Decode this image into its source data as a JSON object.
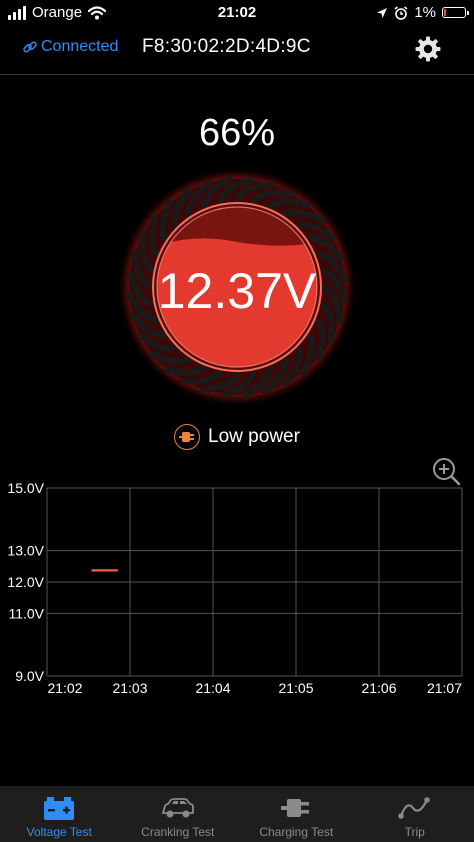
{
  "status_bar": {
    "carrier": "Orange",
    "time": "21:02",
    "battery_percent": "1%"
  },
  "header": {
    "connection_label": "Connected",
    "device_address": "F8:30:02:2D:4D:9C"
  },
  "battery": {
    "percentage_text": "66%",
    "voltage_text": "12.37V",
    "status_text": "Low power",
    "status_icon": "plug-icon"
  },
  "chart_data": {
    "type": "line",
    "x_ticks": [
      "21:02",
      "21:03",
      "21:04",
      "21:05",
      "21:06",
      "21:07"
    ],
    "y_ticks": [
      "15.0V",
      "13.0V",
      "12.0V",
      "11.0V",
      "9.0V"
    ],
    "ylim": [
      9.0,
      15.0
    ],
    "xlim": [
      "21:02",
      "21:07"
    ],
    "grid": true,
    "series": [
      {
        "color": "#e8663a",
        "x": [
          "21:02:20",
          "21:02:40"
        ],
        "y": [
          12.37,
          12.37
        ]
      }
    ]
  },
  "tabs": [
    {
      "label": "Voltage Test",
      "icon": "battery-icon",
      "active": true
    },
    {
      "label": "Cranking Test",
      "icon": "car-icon",
      "active": false
    },
    {
      "label": "Charging Test",
      "icon": "plug-icon",
      "active": false
    },
    {
      "label": "Trip",
      "icon": "trip-icon",
      "active": false
    }
  ],
  "colors": {
    "accent": "#2f8df5",
    "gauge_red": "#e3392f",
    "trace": "#e8663a"
  }
}
